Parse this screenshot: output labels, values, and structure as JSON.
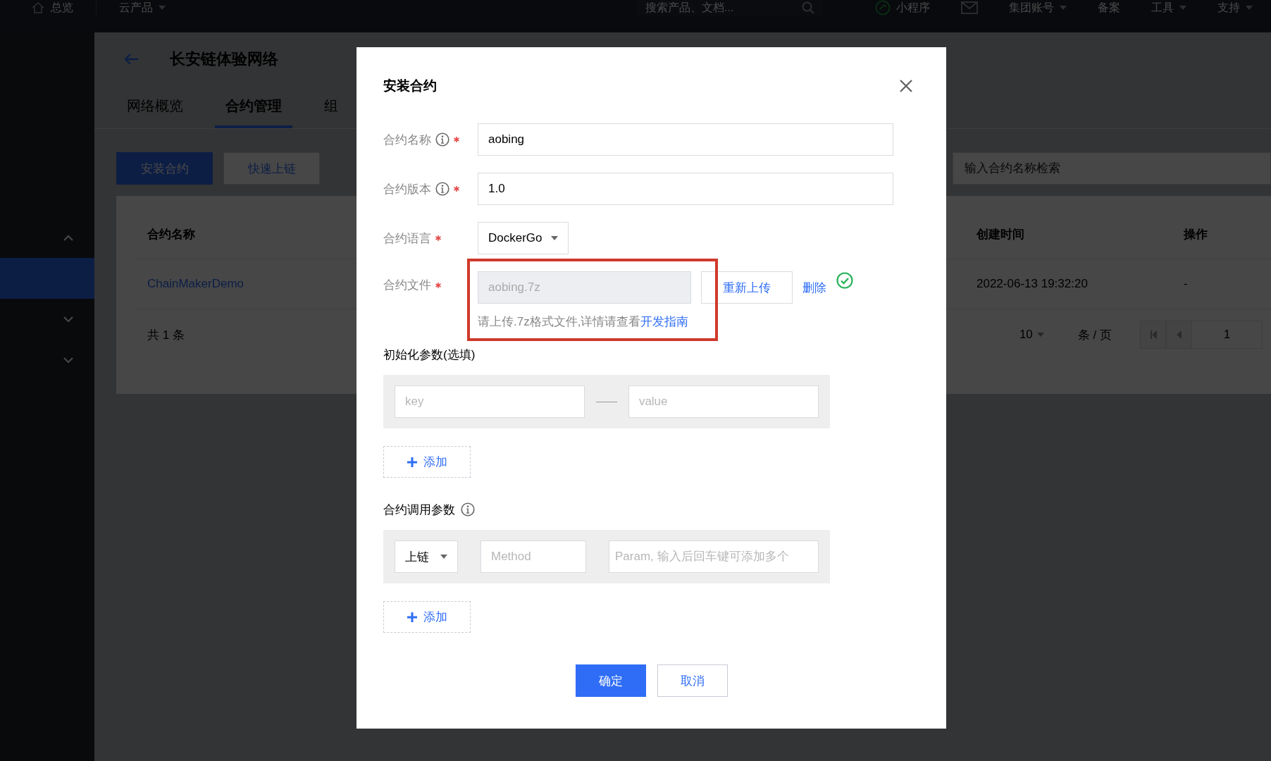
{
  "top_nav": {
    "items": [
      {
        "kind": "home",
        "label": "总览"
      },
      {
        "kind": "dropdown",
        "label": "云产品"
      },
      {
        "kind": "search",
        "placeholder": "搜索产品、文档..."
      },
      {
        "kind": "app",
        "label": "小程序"
      },
      {
        "kind": "mail"
      },
      {
        "kind": "dropdown",
        "label": "集团账号"
      },
      {
        "kind": "plain",
        "label": "备案"
      },
      {
        "kind": "dropdown",
        "label": "工具"
      },
      {
        "kind": "dropdown",
        "label": "支持"
      }
    ]
  },
  "sidebar": {
    "items": [
      {
        "kind": "group",
        "expanded": true,
        "selected": false
      },
      {
        "kind": "item",
        "selected": true
      },
      {
        "kind": "group",
        "expanded": false,
        "selected": false
      },
      {
        "kind": "group",
        "expanded": false,
        "selected": false
      }
    ]
  },
  "page": {
    "title": "长安链体验网络",
    "tabs": [
      {
        "label": "网络概览",
        "selected": false
      },
      {
        "label": "合约管理",
        "selected": true
      },
      {
        "label": "组",
        "selected": false
      }
    ],
    "actions": [
      {
        "label": "安装合约",
        "kind": "primary"
      },
      {
        "label": "快速上链",
        "kind": "secondary"
      }
    ],
    "search": {
      "placeholder": "输入合约名称检索"
    },
    "table": {
      "columns": [
        "合约名称",
        "创建时间",
        "操作"
      ],
      "rows": [
        {
          "cells": [
            "ChainMakerDemo",
            "2022-06-13 19:32:20",
            "-"
          ]
        }
      ]
    },
    "pagination": {
      "total": "共 1 条",
      "page_size": "10",
      "per_page": "条 / 页",
      "page": "1"
    }
  },
  "dialog": {
    "title": "安装合约",
    "fields": [
      {
        "kind": "text",
        "label": "合约名称",
        "info": true,
        "required": true,
        "disabled": false,
        "value": "aobing"
      },
      {
        "kind": "text",
        "label": "合约版本",
        "info": true,
        "required": true,
        "disabled": false,
        "value": "1.0"
      },
      {
        "kind": "select",
        "label": "合约语言",
        "info": false,
        "required": true,
        "disabled": false,
        "value": "DockerGo"
      },
      {
        "kind": "file",
        "label": "合约文件",
        "info": false,
        "required": true,
        "disabled": true,
        "value": "aobing.7z",
        "reupload": "重新上传",
        "remove": "删除",
        "uploaded": true,
        "highlighted": true,
        "hint": "请上传.7z格式文件,详情请查看",
        "hint_link": "开发指南"
      }
    ],
    "init_params": {
      "title": "初始化参数(选填)",
      "info": false,
      "rows": [
        {
          "key_placeholder": "key",
          "value_placeholder": "value"
        }
      ],
      "add": "添加"
    },
    "call_params": {
      "title": "合约调用参数",
      "info": true,
      "rows": [
        {
          "type": "上链",
          "method_placeholder": "Method",
          "param_placeholder": "Param, 输入后回车键可添加多个"
        }
      ],
      "add": "添加"
    },
    "buttons": [
      {
        "label": "确定",
        "kind": "primary"
      },
      {
        "label": "取消",
        "kind": "secondary"
      }
    ]
  }
}
